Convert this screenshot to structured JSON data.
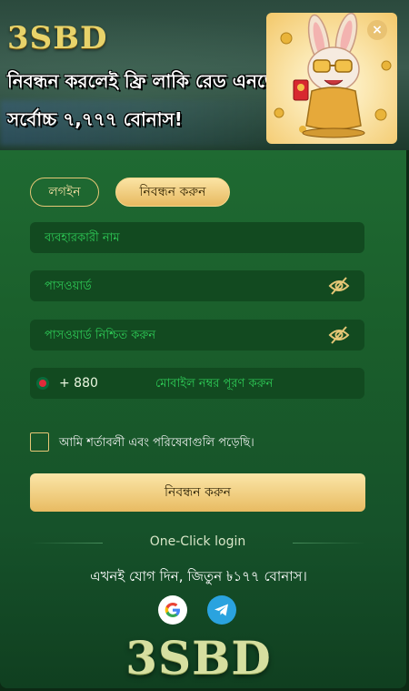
{
  "banner": {
    "logo": "3SBD",
    "headline_line1": "নিবন্ধন করলেই ফ্রি লাকি রেড এনভেলপ",
    "headline_line2": "সর্বোচ্চ ৭,৭৭৭ বোনাস!",
    "close_label": "×"
  },
  "tabs": {
    "login": "লগইন",
    "register": "নিবন্ধন করুন",
    "active": "register"
  },
  "form": {
    "username_placeholder": "ব্যবহারকারী নাম",
    "password_placeholder": "পাসওয়ার্ড",
    "confirm_placeholder": "পাসওয়ার্ড নিশ্চিত করুন",
    "phone_dial_code": "+ 880",
    "phone_placeholder": "মোবাইল নম্বর পূরণ করুন",
    "agree_label": "আমি শর্তাবলী এবং পরিষেবাগুলি পড়েছি।",
    "agree_checked": false,
    "submit_label": "নিবন্ধন করুন"
  },
  "one_click": {
    "label": "One-Click login",
    "promo": "এখনই যোগ দিন, জিতুন ৳১৭৭ বোনাস।",
    "providers": [
      "google-icon",
      "telegram-icon"
    ]
  },
  "footer": {
    "logo": "3SBD"
  },
  "colors": {
    "accent_gold": "#e7b960",
    "card_green": "#1a5e2b",
    "placeholder_green": "#2fce58"
  }
}
